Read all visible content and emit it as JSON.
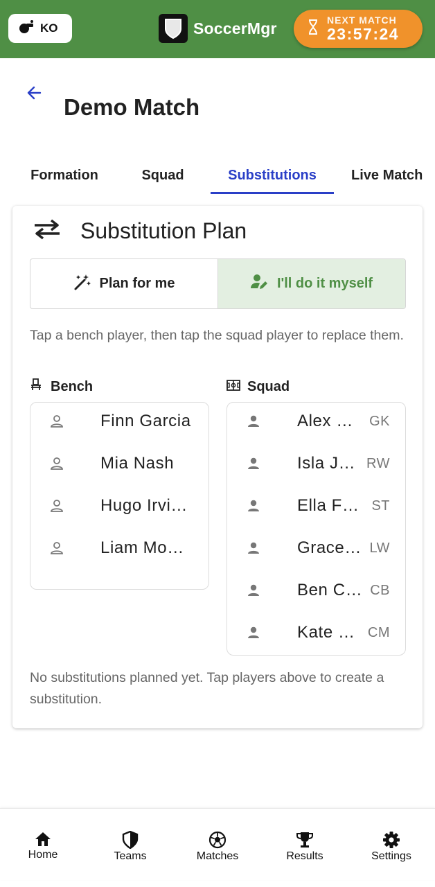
{
  "header": {
    "ko_label": "KO",
    "brand_name": "SoccerMgr",
    "next_match_label": "NEXT MATCH",
    "next_match_countdown": "23:57:24",
    "bar_color": "#4f8f45",
    "next_match_color": "#f0922b"
  },
  "page": {
    "title": "Demo Match"
  },
  "tabs": [
    {
      "label": "Formation",
      "active": false
    },
    {
      "label": "Squad",
      "active": false
    },
    {
      "label": "Substitutions",
      "active": true
    },
    {
      "label": "Live Match",
      "active": false
    }
  ],
  "card": {
    "title": "Substitution Plan",
    "mode_options": [
      {
        "label": "Plan for me",
        "icon": "magic-wand-icon",
        "selected": false
      },
      {
        "label": "I'll do it myself",
        "icon": "person-edit-icon",
        "selected": true
      }
    ],
    "hint": "Tap a bench player, then tap the squad player to replace them.",
    "bench": {
      "heading": "Bench",
      "icon": "bench-seat-icon",
      "players": [
        {
          "name": "Finn Garcia"
        },
        {
          "name": "Mia Nash"
        },
        {
          "name": "Hugo Irvi…"
        },
        {
          "name": "Liam Mo…"
        }
      ]
    },
    "squad": {
      "heading": "Squad",
      "icon": "pitch-icon",
      "players": [
        {
          "name": "Alex M…",
          "position": "GK"
        },
        {
          "name": "Isla Ja…",
          "position": "RW"
        },
        {
          "name": "Ella Fo…",
          "position": "ST"
        },
        {
          "name": "Grace …",
          "position": "LW"
        },
        {
          "name": "Ben Ca…",
          "position": "CB"
        },
        {
          "name": "Kate L…",
          "position": "CM"
        }
      ]
    },
    "empty_note": "No substitutions planned yet. Tap players above to create a substitution."
  },
  "bottom_nav": [
    {
      "label": "Home",
      "icon": "home-icon"
    },
    {
      "label": "Teams",
      "icon": "shield-icon"
    },
    {
      "label": "Matches",
      "icon": "soccer-ball-icon"
    },
    {
      "label": "Results",
      "icon": "trophy-icon"
    },
    {
      "label": "Settings",
      "icon": "gear-icon"
    }
  ],
  "colors": {
    "accent_blue": "#2a3fc7",
    "selected_bg": "#e3efe1",
    "selected_text": "#4f8f45"
  }
}
